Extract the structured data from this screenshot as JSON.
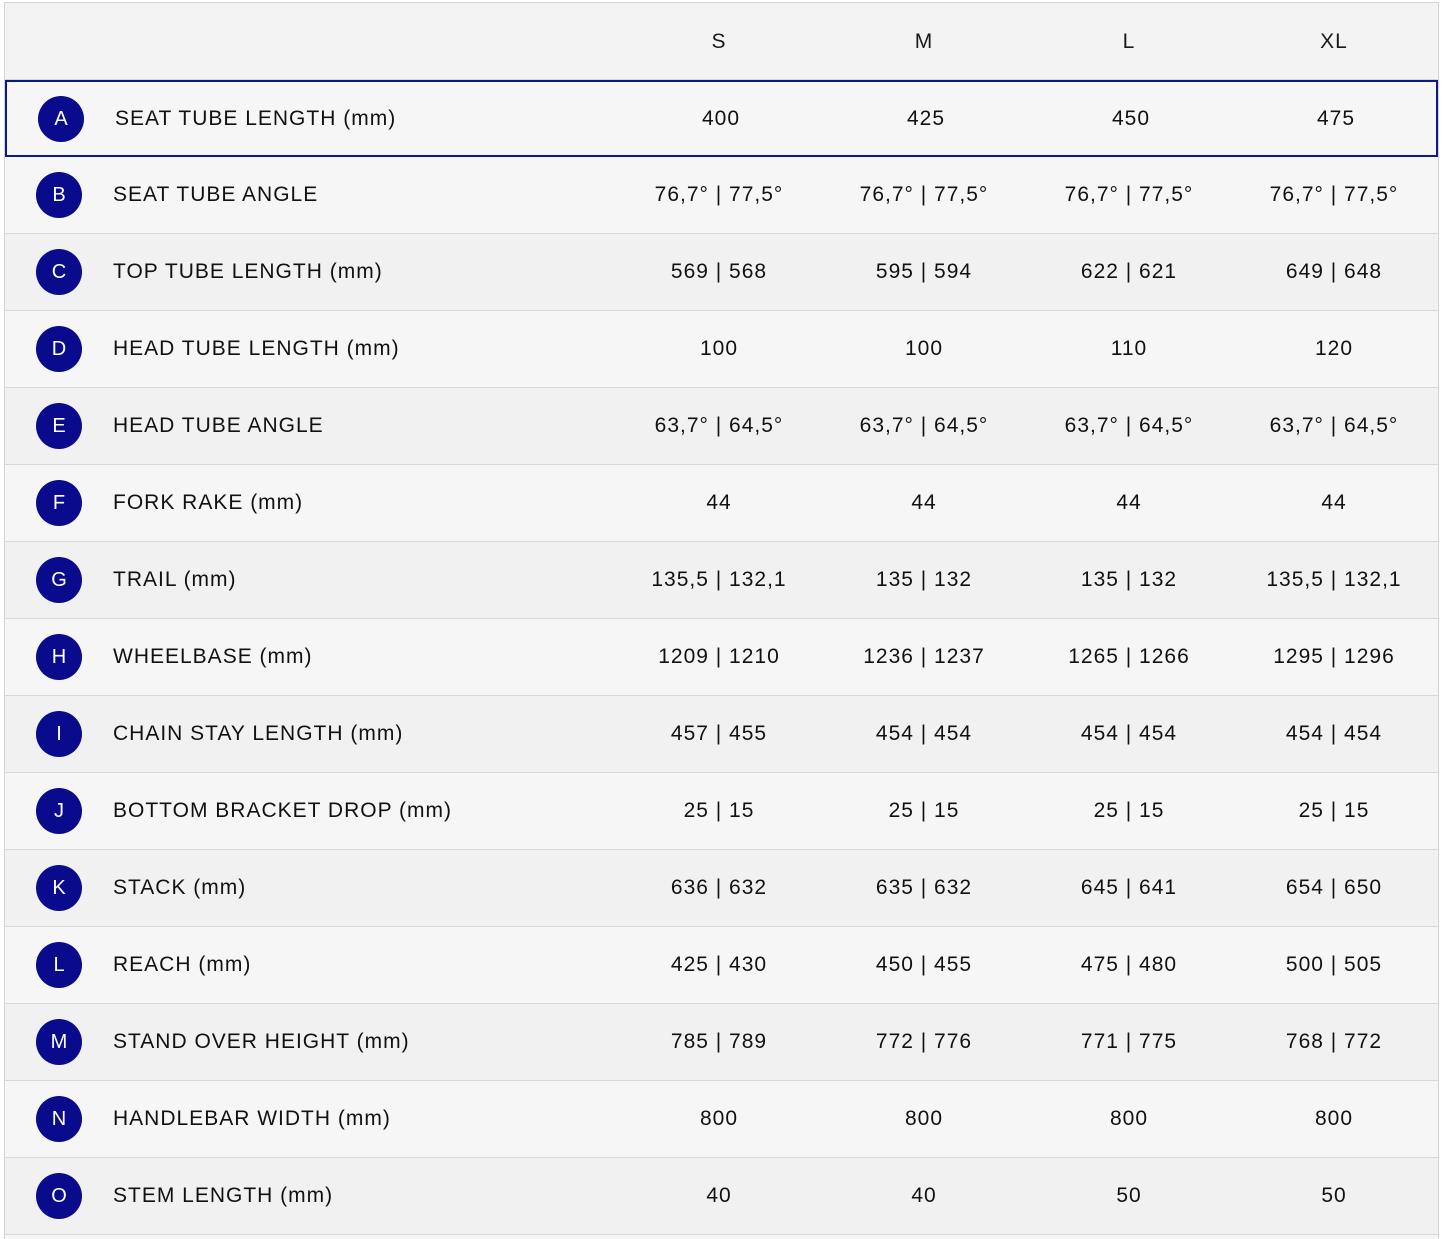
{
  "table": {
    "sizes": [
      "S",
      "M",
      "L",
      "XL"
    ],
    "rows": [
      {
        "letter": "A",
        "label": "SEAT TUBE LENGTH (mm)",
        "values": [
          "400",
          "425",
          "450",
          "475"
        ]
      },
      {
        "letter": "B",
        "label": "SEAT TUBE ANGLE",
        "values": [
          "76,7° | 77,5°",
          "76,7° | 77,5°",
          "76,7° | 77,5°",
          "76,7° | 77,5°"
        ]
      },
      {
        "letter": "C",
        "label": "TOP TUBE LENGTH (mm)",
        "values": [
          "569 | 568",
          "595 | 594",
          "622 | 621",
          "649 | 648"
        ]
      },
      {
        "letter": "D",
        "label": "HEAD TUBE LENGTH (mm)",
        "values": [
          "100",
          "100",
          "110",
          "120"
        ]
      },
      {
        "letter": "E",
        "label": "HEAD TUBE ANGLE",
        "values": [
          "63,7° | 64,5°",
          "63,7° | 64,5°",
          "63,7° | 64,5°",
          "63,7° | 64,5°"
        ]
      },
      {
        "letter": "F",
        "label": "FORK RAKE (mm)",
        "values": [
          "44",
          "44",
          "44",
          "44"
        ]
      },
      {
        "letter": "G",
        "label": "TRAIL (mm)",
        "values": [
          "135,5 | 132,1",
          "135 | 132",
          "135 | 132",
          "135,5 | 132,1"
        ]
      },
      {
        "letter": "H",
        "label": "WHEELBASE (mm)",
        "values": [
          "1209 | 1210",
          "1236 | 1237",
          "1265 | 1266",
          "1295 | 1296"
        ]
      },
      {
        "letter": "I",
        "label": "CHAIN STAY LENGTH (mm)",
        "values": [
          "457 | 455",
          "454 | 454",
          "454 | 454",
          "454 | 454"
        ]
      },
      {
        "letter": "J",
        "label": "BOTTOM BRACKET DROP (mm)",
        "values": [
          "25 | 15",
          "25 | 15",
          "25 | 15",
          "25 | 15"
        ]
      },
      {
        "letter": "K",
        "label": "STACK (mm)",
        "values": [
          "636 | 632",
          "635 | 632",
          "645 | 641",
          "654 | 650"
        ]
      },
      {
        "letter": "L",
        "label": "REACH (mm)",
        "values": [
          "425 | 430",
          "450 | 455",
          "475 | 480",
          "500 | 505"
        ]
      },
      {
        "letter": "M",
        "label": "STAND OVER HEIGHT (mm)",
        "values": [
          "785 | 789",
          "772 | 776",
          "771 | 775",
          "768 | 772"
        ]
      },
      {
        "letter": "N",
        "label": "HANDLEBAR WIDTH (mm)",
        "values": [
          "800",
          "800",
          "800",
          "800"
        ]
      },
      {
        "letter": "O",
        "label": "STEM LENGTH (mm)",
        "values": [
          "40",
          "40",
          "50",
          "50"
        ]
      }
    ]
  },
  "colors": {
    "badge": "#0a0a8c",
    "selected_border": "#0e1a7e",
    "row_bg": "#f6f6f6",
    "divider": "#d8d8d8"
  }
}
